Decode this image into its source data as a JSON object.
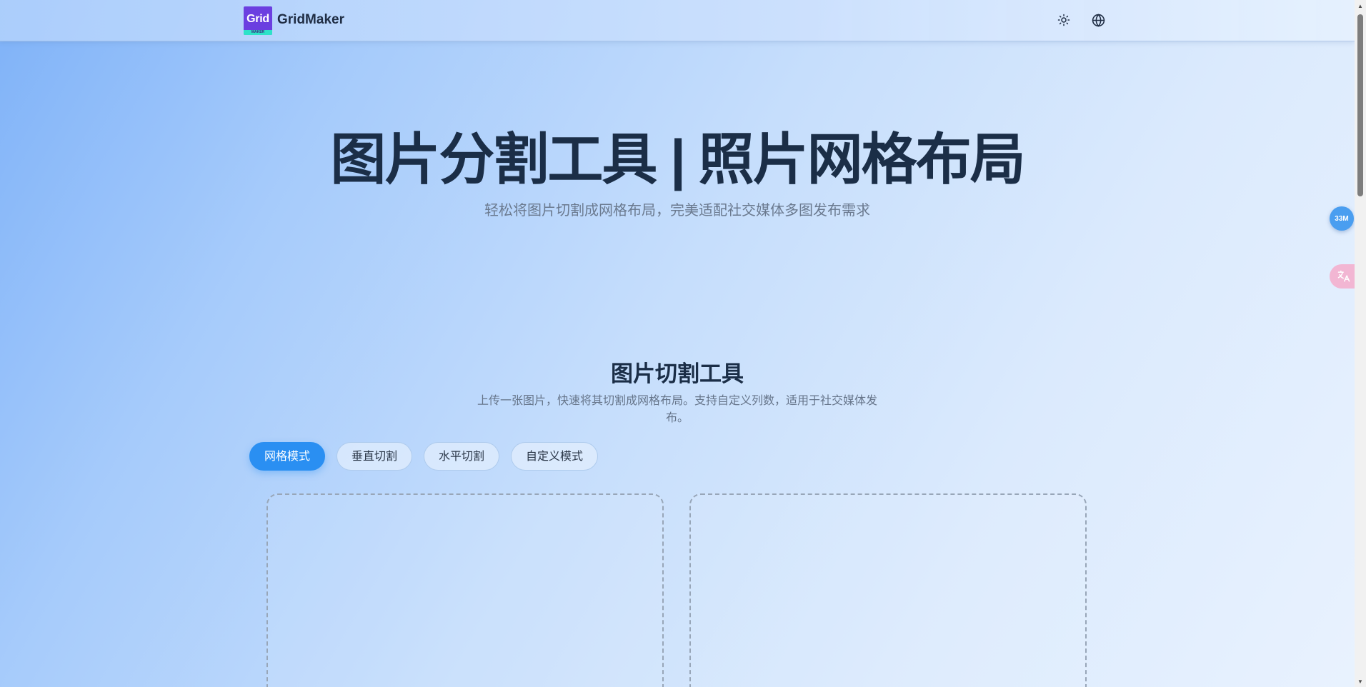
{
  "header": {
    "logo_text": "Grid",
    "logo_subtext": "MAKER",
    "brand": "GridMaker",
    "icons": [
      "sun-icon",
      "globe-icon"
    ]
  },
  "hero": {
    "title": "图片分割工具 | 照片网格布局",
    "subtitle": "轻松将图片切割成网格布局，完美适配社交媒体多图发布需求"
  },
  "tool": {
    "title": "图片切割工具",
    "description": "上传一张图片，快速将其切割成网格布局。支持自定义列数，适用于社交媒体发布。",
    "tabs": [
      {
        "label": "网格模式",
        "active": true
      },
      {
        "label": "垂直切割",
        "active": false
      },
      {
        "label": "水平切割",
        "active": false
      },
      {
        "label": "自定义模式",
        "active": false
      }
    ]
  },
  "floating": {
    "badge": "33M",
    "translate_icon": "translate-icon"
  },
  "colors": {
    "accent": "#2a8ff2",
    "logo_purple": "#6b3fe0",
    "logo_teal": "#2de2c8",
    "heading": "#1b2e47"
  }
}
